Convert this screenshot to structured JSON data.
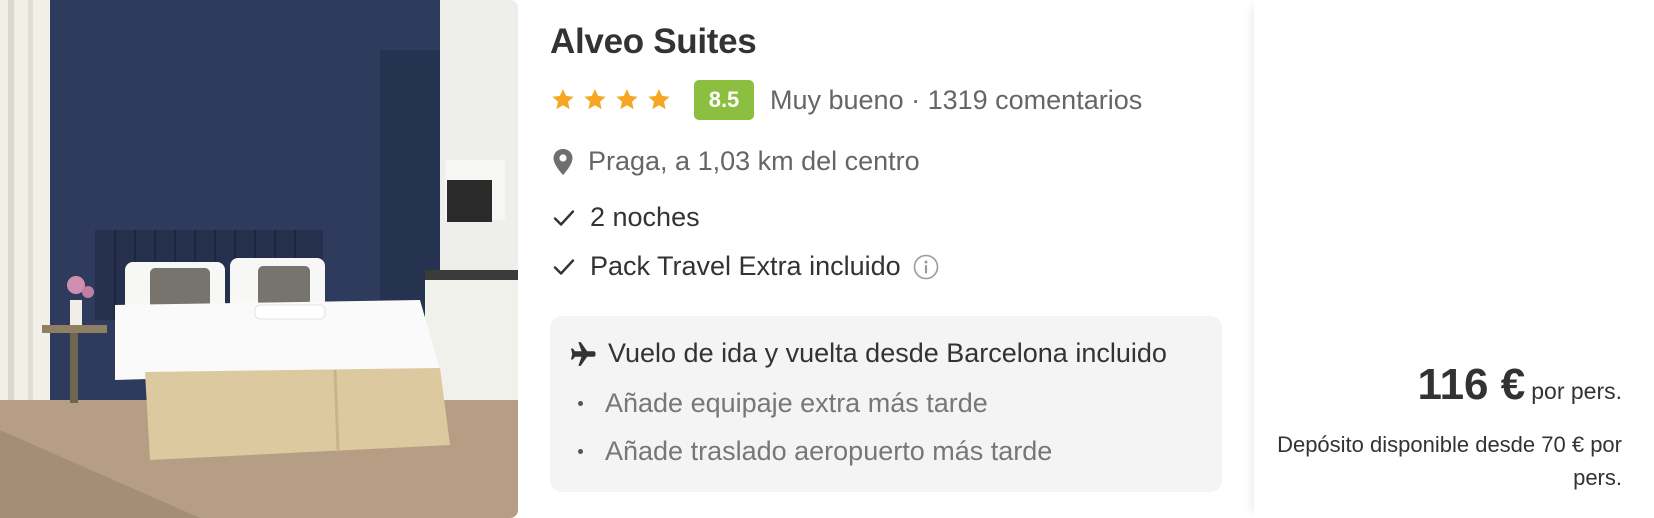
{
  "hotel": {
    "name": "Alveo Suites",
    "stars": 4,
    "score": "8.5",
    "score_text": "Muy bueno · 1319 comentarios",
    "location": "Praga, a 1,03 km del centro"
  },
  "features": [
    {
      "label": "2 noches",
      "icon": "check-icon"
    },
    {
      "label": "Pack Travel Extra incluido",
      "icon": "check-icon",
      "extra_icon": "info-icon"
    }
  ],
  "flight": {
    "title": "Vuelo de ida y vuelta desde Barcelona incluido",
    "icon": "plane-icon",
    "options": [
      "Añade equipaje extra más tarde",
      "Añade traslado aeropuerto más tarde"
    ]
  },
  "price": {
    "amount": "116 €",
    "per": "por pers.",
    "deposit": "Depósito disponible desde 70 € por pers."
  },
  "colors": {
    "star": "#f5a623",
    "score_bg": "#8cbf3f",
    "box_bg": "#f4f4f4"
  }
}
